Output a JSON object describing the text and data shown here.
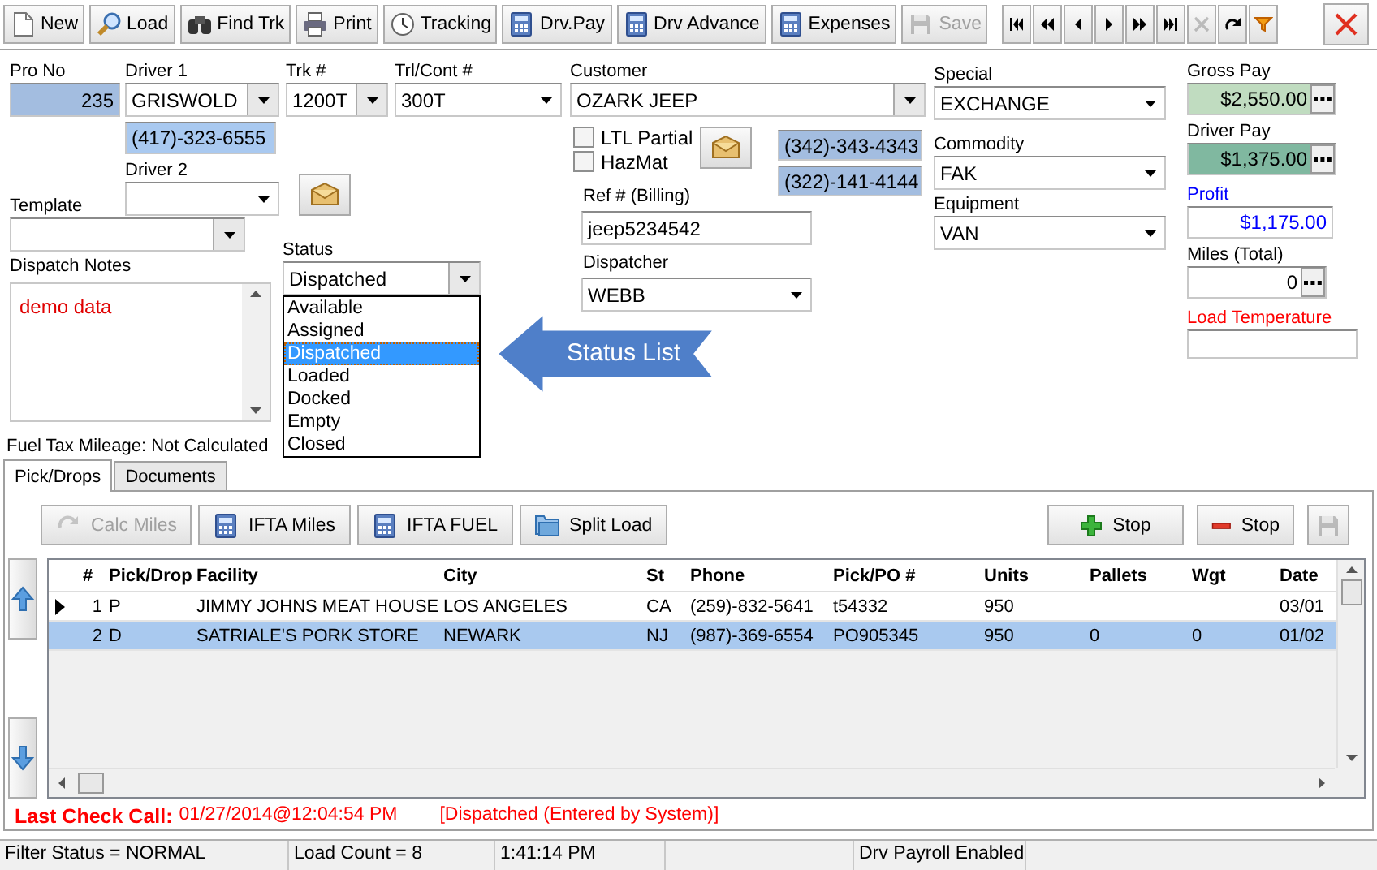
{
  "toolbar": {
    "buttons": [
      {
        "label": "New",
        "kind": "page",
        "disabled": false
      },
      {
        "label": "Load",
        "kind": "magnifier",
        "disabled": false
      },
      {
        "label": "Find Trk",
        "kind": "binoculars",
        "disabled": false
      },
      {
        "label": "Print",
        "kind": "printer",
        "disabled": false
      },
      {
        "label": "Tracking",
        "kind": "clock",
        "disabled": false
      },
      {
        "label": "Drv.Pay",
        "kind": "calculator",
        "disabled": false
      },
      {
        "label": "Drv Advance",
        "kind": "calculator",
        "disabled": false
      },
      {
        "label": "Expenses",
        "kind": "calculator",
        "disabled": false
      },
      {
        "label": "Save",
        "kind": "floppy",
        "disabled": true
      }
    ],
    "nav": [
      {
        "kind": "first",
        "disabled": false
      },
      {
        "kind": "page-back",
        "disabled": false
      },
      {
        "kind": "back",
        "disabled": false
      },
      {
        "kind": "forward",
        "disabled": false
      },
      {
        "kind": "page-forward",
        "disabled": false
      },
      {
        "kind": "last",
        "disabled": false
      },
      {
        "kind": "cancel",
        "disabled": true
      },
      {
        "kind": "redo",
        "disabled": false
      },
      {
        "kind": "filter",
        "disabled": false
      }
    ]
  },
  "form": {
    "pro_no": {
      "label": "Pro No",
      "value": "235"
    },
    "driver1": {
      "label": "Driver 1",
      "value": "GRISWOLD",
      "phone": "(417)-323-6555"
    },
    "truck": {
      "label": "Trk #",
      "value": "1200T"
    },
    "trailer": {
      "label": "Trl/Cont #",
      "value": "300T"
    },
    "driver2": {
      "label": "Driver 2"
    },
    "template": {
      "label": "Template"
    },
    "dispatch_notes": {
      "label": "Dispatch Notes",
      "value": "demo data"
    },
    "status": {
      "label": "Status",
      "value": "Dispatched",
      "expanded": true,
      "options": [
        {
          "label": "Available",
          "selected": false
        },
        {
          "label": "Assigned",
          "selected": false
        },
        {
          "label": "Dispatched",
          "selected": true
        },
        {
          "label": "Loaded",
          "selected": false
        },
        {
          "label": "Docked",
          "selected": false
        },
        {
          "label": "Empty",
          "selected": false
        },
        {
          "label": "Closed",
          "selected": false
        }
      ]
    },
    "fuel_tax": {
      "label": "Fuel Tax Mileage:",
      "value": "Not Calculated"
    },
    "customer": {
      "label": "Customer",
      "value": "OZARK  JEEP"
    },
    "flags": [
      {
        "label": "LTL Partial",
        "checked": false
      },
      {
        "label": "HazMat",
        "checked": false
      }
    ],
    "customer_phones": [
      "(342)-343-4343",
      "(322)-141-4144"
    ],
    "ref": {
      "label": "Ref # (Billing)",
      "value": "jeep5234542"
    },
    "dispatcher": {
      "label": "Dispatcher",
      "value": "WEBB"
    },
    "special": {
      "label": "Special",
      "value": "EXCHANGE"
    },
    "commodity": {
      "label": "Commodity",
      "value": "FAK"
    },
    "equipment": {
      "label": "Equipment",
      "value": "VAN"
    },
    "gross_pay": {
      "label": "Gross Pay",
      "value": "$2,550.00"
    },
    "driver_pay": {
      "label": "Driver Pay",
      "value": "$1,375.00"
    },
    "profit": {
      "label": "Profit",
      "value": "$1,175.00"
    },
    "miles": {
      "label": "Miles (Total)",
      "value": "0"
    },
    "load_temperature": {
      "label": "Load Temperature"
    }
  },
  "callout": {
    "text": "Status List"
  },
  "tabs": [
    {
      "label": "Pick/Drops",
      "selected": true
    },
    {
      "label": "Documents",
      "selected": false
    }
  ],
  "panel_buttons": [
    {
      "label": "Calc Miles",
      "kind": "refresh",
      "disabled": true
    },
    {
      "label": "IFTA Miles",
      "kind": "calculator",
      "disabled": false
    },
    {
      "label": "IFTA FUEL",
      "kind": "calculator",
      "disabled": false
    },
    {
      "label": "Split Load",
      "kind": "folders",
      "disabled": false
    }
  ],
  "stop_buttons": [
    {
      "label": "Stop",
      "kind": "plus",
      "disabled": false
    },
    {
      "label": "Stop",
      "kind": "minus",
      "disabled": false
    }
  ],
  "save_stops": {
    "disabled": true
  },
  "table": {
    "columns": [
      "#",
      "Pick/Drop",
      "Facility",
      "City",
      "St",
      "Phone",
      "Pick/PO #",
      "Units",
      "Pallets",
      "Wgt",
      "Date"
    ],
    "rows": [
      {
        "current": true,
        "selected": false,
        "cells": [
          "1",
          "P",
          "JIMMY JOHNS MEAT HOUSE",
          "LOS ANGELES",
          "CA",
          "(259)-832-5641",
          "t54332",
          "950",
          null,
          null,
          "03/01"
        ]
      },
      {
        "current": false,
        "selected": true,
        "cells": [
          "2",
          "D",
          "SATRIALE'S PORK STORE",
          "NEWARK",
          "NJ",
          "(987)-369-6554",
          "PO905345",
          "950",
          "0",
          "0",
          "01/02"
        ]
      }
    ]
  },
  "last_check_call": {
    "label": "Last Check Call:",
    "time": "01/27/2014@12:04:54 PM",
    "note": "[Dispatched (Entered by System)]"
  },
  "status_bar": [
    "Filter Status = NORMAL",
    "Load Count = 8",
    "1:41:14 PM",
    "Drv Payroll Enabled"
  ]
}
